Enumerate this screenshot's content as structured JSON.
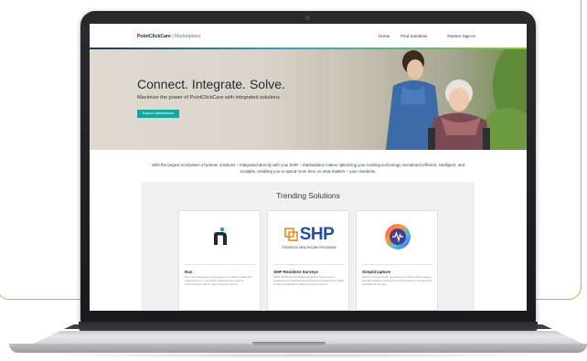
{
  "site": {
    "brand_name": "PointClickCare",
    "brand_sub": " | Marketplace",
    "nav": [
      {
        "label": "Home"
      },
      {
        "label": "Find Solutions"
      },
      {
        "label": "Partner Sign-in"
      }
    ]
  },
  "hero": {
    "title": "Connect. Integrate. Solve.",
    "subtitle": "Maximize the power of PointClickCare with integrated solutions",
    "button_label": "Explore Marketplace"
  },
  "intro": {
    "text": "With the largest ecosystem of partner solutions – integrated directly with your EHR – Marketplace makes optimizing your existing technology investment efficient, intelligent, and scalable, enabling you to spend more time on what matters – your residents."
  },
  "trending": {
    "title": "Trending Solutions",
    "cards": [
      {
        "logo_text": "n",
        "title": "Nuz",
        "description": "Nuz is the easiest app to keep everyone on staff up-to-date with what's going on in your homes. Streamline your internal communications with our easy-to-use app that can."
      },
      {
        "logo_text": "SHP",
        "logo_caption": "STRATEGIC HEALTHCARE PROGRAMS",
        "title": "SHP Resident Surveys",
        "description": "SHP's CAHPS Resident/Family Experience Surveys aim to enhance person-centered care and promote transparency in skilled nursing as these benchmarking experience surveys."
      },
      {
        "logo_text": "",
        "title": "SimpliCapture",
        "description": "Discover powerful AI with time-savings for efficient charge capture and data collection. Designed for medical practices in its ease and specialties for all types."
      }
    ]
  },
  "colors": {
    "frame": "#9bc53d",
    "hero_button": "#13a7a0",
    "shp_orange": "#f08a1c",
    "shp_blue": "#1f4fa0"
  }
}
